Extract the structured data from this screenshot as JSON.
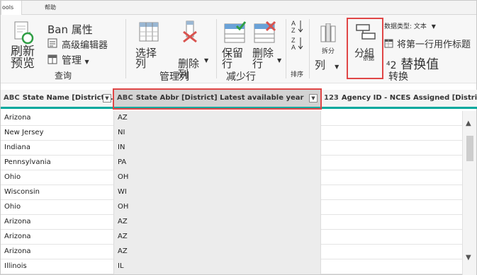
{
  "tabs": [
    {
      "label": "ools",
      "active": true
    },
    {
      "label": "帮助",
      "active": false
    }
  ],
  "ribbon": {
    "query": {
      "refresh_label": "刷新\n预览",
      "properties_label": "属性",
      "properties_prefix": "Ban",
      "advanced_editor_label": "高级编辑器",
      "manage_label": "管理",
      "group_label": "查询"
    },
    "manage_columns": {
      "choose_label": "选择\n列",
      "remove_label": "删除\n列",
      "group_label": "管理列"
    },
    "reduce_rows": {
      "keep_label": "保留\n行",
      "remove_label": "删除\n行",
      "group_label": "减少行"
    },
    "sort": {
      "group_label": "排序"
    },
    "split": {
      "label_top": "拆分",
      "label_bottom": "列"
    },
    "group_by": {
      "label_top": "分組",
      "label_bottom": "依据"
    },
    "transform": {
      "data_type_label": "数据类型: 文本",
      "first_row_header_label": "将第一行用作标题",
      "replace_values_label": "替换值",
      "replace_prefix": "⁴2",
      "group_label": "转换"
    }
  },
  "grid": {
    "columns": [
      {
        "type_icon": "ABC",
        "title": "State Name [District]...",
        "selected": false
      },
      {
        "type_icon": "ABC",
        "title": "State Abbr [District] Latest available year",
        "selected": true
      },
      {
        "type_icon": "123",
        "title": "Agency ID - NCES Assigned [District] La",
        "selected": false
      }
    ],
    "rows": [
      [
        "Arizona",
        "AZ",
        ""
      ],
      [
        "New Jersey",
        "NI",
        ""
      ],
      [
        "Indiana",
        "IN",
        ""
      ],
      [
        "Pennsylvania",
        "PA",
        ""
      ],
      [
        "Ohio",
        "OH",
        ""
      ],
      [
        "Wisconsin",
        "WI",
        ""
      ],
      [
        "Ohio",
        "OH",
        ""
      ],
      [
        "Arizona",
        "AZ",
        ""
      ],
      [
        "Arizona",
        "AZ",
        ""
      ],
      [
        "Arizona",
        "AZ",
        ""
      ],
      [
        "Illinois",
        "IL",
        ""
      ]
    ]
  },
  "colors": {
    "accent_teal": "#00a89d",
    "highlight_red": "#e04646",
    "selected_header": "#d3d3d3"
  },
  "icons": [
    "refresh-icon",
    "properties-icon",
    "advanced-editor-icon",
    "manage-icon",
    "choose-columns-icon",
    "remove-columns-icon",
    "keep-rows-icon",
    "remove-rows-icon",
    "sort-ascending-icon",
    "sort-descending-icon",
    "split-column-icon",
    "group-by-icon",
    "data-type-icon",
    "first-row-header-icon",
    "replace-values-icon"
  ]
}
